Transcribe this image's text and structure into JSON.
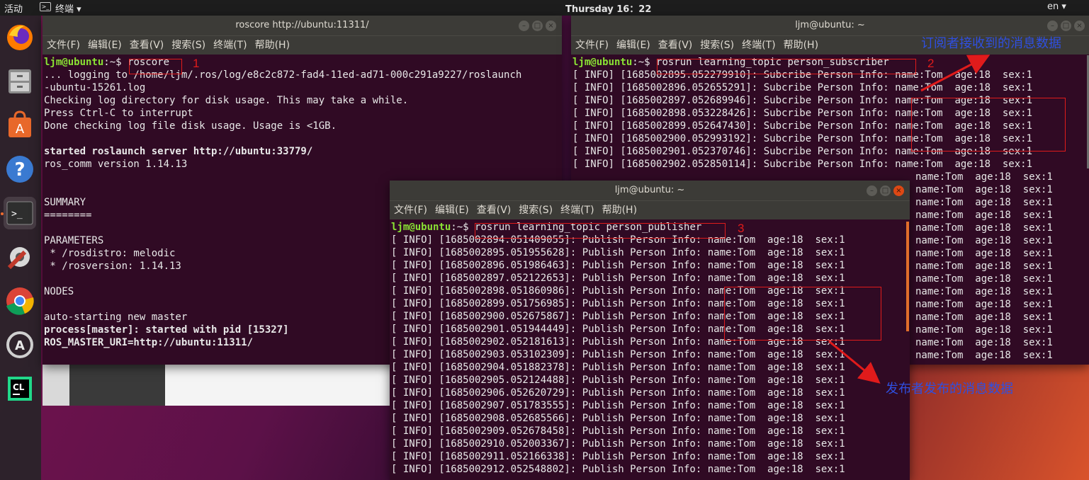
{
  "topbar": {
    "activities": "活动",
    "app_menu": "终端 ▾",
    "clock": "Thursday 16：22",
    "lang": "en ▾"
  },
  "dock": {
    "icons": [
      "firefox-icon",
      "files-icon",
      "software-center-icon",
      "help-icon",
      "terminal-icon",
      "settings-icon",
      "chrome-icon",
      "updater-icon",
      "clion-icon"
    ]
  },
  "menu": [
    "文件(F)",
    "编辑(E)",
    "查看(V)",
    "搜索(S)",
    "终端(T)",
    "帮助(H)"
  ],
  "terminals": {
    "roscore": {
      "title": "roscore http://ubuntu:11311/",
      "prompt_user": "ljm@ubuntu",
      "prompt_path": ":~$ ",
      "command": "roscore",
      "lines": [
        "... logging to /home/ljm/.ros/log/e8c2c872-fad4-11ed-ad71-000c291a9227/roslaunch",
        "-ubuntu-15261.log",
        "Checking log directory for disk usage. This may take a while.",
        "Press Ctrl-C to interrupt",
        "Done checking log file disk usage. Usage is <1GB.",
        "",
        "started roslaunch server http://ubuntu:33779/",
        "ros_comm version 1.14.13",
        "",
        "",
        "SUMMARY",
        "========",
        "",
        "PARAMETERS",
        " * /rosdistro: melodic",
        " * /rosversion: 1.14.13",
        "",
        "NODES",
        "",
        "auto-starting new master",
        "process[master]: started with pid [15327]",
        "ROS_MASTER_URI=http://ubuntu:11311/"
      ]
    },
    "subscriber": {
      "title": "ljm@ubuntu: ~",
      "prompt_user": "ljm@ubuntu",
      "prompt_path": ":~$ ",
      "command": "rosrun learning_topic person_subscriber",
      "lines": [
        "[ INFO] [1685002895.052279910]: Subcribe Person Info: name:Tom  age:18  sex:1",
        "[ INFO] [1685002896.052655291]: Subcribe Person Info: name:Tom  age:18  sex:1",
        "[ INFO] [1685002897.052689946]: Subcribe Person Info: name:Tom  age:18  sex:1",
        "[ INFO] [1685002898.053228426]: Subcribe Person Info: name:Tom  age:18  sex:1",
        "[ INFO] [1685002899.052647430]: Subcribe Person Info: name:Tom  age:18  sex:1",
        "[ INFO] [1685002900.052993192]: Subcribe Person Info: name:Tom  age:18  sex:1",
        "[ INFO] [1685002901.052370746]: Subcribe Person Info: name:Tom  age:18  sex:1",
        "[ INFO] [1685002902.052850114]: Subcribe Person Info: name:Tom  age:18  sex:1"
      ],
      "hidden_tail": "name:Tom  age:18  sex:1"
    },
    "publisher": {
      "title": "ljm@ubuntu: ~",
      "prompt_user": "ljm@ubuntu",
      "prompt_path": ":~$ ",
      "command": "rosrun learning_topic person_publisher",
      "lines": [
        "[ INFO] [1685002894.051409055]: Publish Person Info: name:Tom  age:18  sex:1",
        "[ INFO] [1685002895.051955628]: Publish Person Info: name:Tom  age:18  sex:1",
        "[ INFO] [1685002896.051986463]: Publish Person Info: name:Tom  age:18  sex:1",
        "[ INFO] [1685002897.052122653]: Publish Person Info: name:Tom  age:18  sex:1",
        "[ INFO] [1685002898.051860986]: Publish Person Info: name:Tom  age:18  sex:1",
        "[ INFO] [1685002899.051756985]: Publish Person Info: name:Tom  age:18  sex:1",
        "[ INFO] [1685002900.052675867]: Publish Person Info: name:Tom  age:18  sex:1",
        "[ INFO] [1685002901.051944449]: Publish Person Info: name:Tom  age:18  sex:1",
        "[ INFO] [1685002902.052181613]: Publish Person Info: name:Tom  age:18  sex:1",
        "[ INFO] [1685002903.053102309]: Publish Person Info: name:Tom  age:18  sex:1",
        "[ INFO] [1685002904.051882378]: Publish Person Info: name:Tom  age:18  sex:1",
        "[ INFO] [1685002905.052124488]: Publish Person Info: name:Tom  age:18  sex:1",
        "[ INFO] [1685002906.052620729]: Publish Person Info: name:Tom  age:18  sex:1",
        "[ INFO] [1685002907.051783555]: Publish Person Info: name:Tom  age:18  sex:1",
        "[ INFO] [1685002908.052685566]: Publish Person Info: name:Tom  age:18  sex:1",
        "[ INFO] [1685002909.052678458]: Publish Person Info: name:Tom  age:18  sex:1",
        "[ INFO] [1685002910.052003367]: Publish Person Info: name:Tom  age:18  sex:1",
        "[ INFO] [1685002911.052166338]: Publish Person Info: name:Tom  age:18  sex:1",
        "[ INFO] [1685002912.052548802]: Publish Person Info: name:Tom  age:18  sex:1"
      ]
    }
  },
  "annotations": {
    "num1": "1",
    "num2": "2",
    "num3": "3",
    "subscriber_label": "订阅者接收到的消息数据",
    "publisher_label": "发布者发布的消息数据"
  },
  "colors": {
    "terminal_bg": "#300a24",
    "prompt_user": "#8ae234",
    "prompt_path": "#729fcf",
    "annotation_red": "#e01b1b",
    "annotation_blue": "#2f4fe0"
  }
}
